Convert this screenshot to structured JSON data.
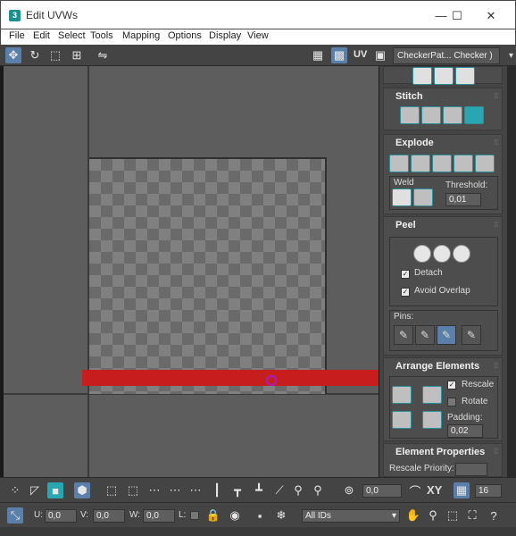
{
  "window": {
    "title": "Edit UVWs",
    "app_icon": "3",
    "minimize": "—",
    "maximize": "☐",
    "close": "✕"
  },
  "menu": [
    "File",
    "Edit",
    "Select",
    "Tools",
    "Mapping",
    "Options",
    "Display",
    "View"
  ],
  "toolbar": {
    "uv_label": "UV",
    "checker_dropdown": "CheckerPat... Checker )",
    "dropdown_arrow": "▾"
  },
  "panel": {
    "stitch": {
      "title": "Stitch"
    },
    "explode": {
      "title": "Explode",
      "weld_label": "Weld",
      "threshold_label": "Threshold:",
      "threshold_value": "0,01"
    },
    "peel": {
      "title": "Peel",
      "detach_label": "Detach",
      "avoid_overlap_label": "Avoid Overlap",
      "pins_label": "Pins:"
    },
    "arrange": {
      "title": "Arrange Elements",
      "rescale_label": "Rescale",
      "rotate_label": "Rotate",
      "padding_label": "Padding:",
      "padding_value": "0,02"
    },
    "element_props": {
      "title": "Element Properties",
      "rescale_priority_label": "Rescale Priority:"
    },
    "grip": "⁞⁞"
  },
  "bottom": {
    "soft_value": "0,0",
    "xy_label": "XY",
    "grid_value": "16",
    "u_label": "U:",
    "u_value": "0,0",
    "v_label": "V:",
    "v_value": "0,0",
    "w_label": "W:",
    "w_value": "0,0",
    "l_label": "L:",
    "ids_dropdown": "All IDs"
  },
  "colors": {
    "accent_teal": "#2aa6b3",
    "selection_red": "#c81d1d",
    "pivot_purple": "#a020c0",
    "panel_bg": "#444444"
  }
}
